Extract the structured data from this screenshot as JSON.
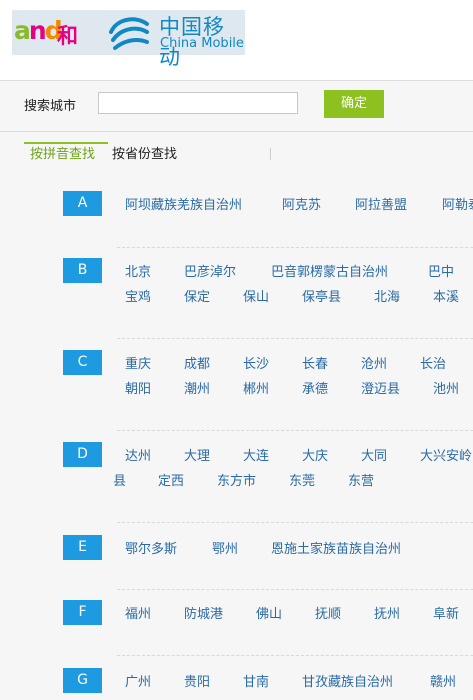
{
  "header": {
    "and_logo": {
      "a": "a",
      "n": "n",
      "d": "d"
    },
    "he_label": "和",
    "brand_cn": "中国移动",
    "brand_en": "China Mobile"
  },
  "search": {
    "label": "搜索城市",
    "input_value": "",
    "placeholder": "",
    "button_label": "确定"
  },
  "tabs": {
    "pinyin": "按拼音查找",
    "province": "按省份查找"
  },
  "colors": {
    "accent_green": "#8cc11f",
    "letter_blue": "#1d9ae0",
    "link_blue": "#2a6aa8",
    "and_green": "#8ab82f",
    "and_pink": "#e4007f",
    "and_orange": "#f08a00",
    "brand_blue": "#1088c8"
  },
  "groups": {
    "A": {
      "letter": "A",
      "cities": [
        "阿坝藏族羌族自治州",
        "阿克苏",
        "阿拉善盟",
        "阿勒泰"
      ]
    },
    "B": {
      "letter": "B",
      "cities": [
        "北京",
        "巴彦淖尔",
        "巴音郭楞蒙古自治州",
        "巴中",
        "宝鸡",
        "保定",
        "保山",
        "保亭县",
        "北海",
        "本溪"
      ]
    },
    "C": {
      "letter": "C",
      "cities": [
        "重庆",
        "成都",
        "长沙",
        "长春",
        "沧州",
        "长治",
        "朝阳",
        "潮州",
        "郴州",
        "承德",
        "澄迈县",
        "池州"
      ]
    },
    "D": {
      "letter": "D",
      "cities": [
        "达州",
        "大理",
        "大连",
        "大庆",
        "大同",
        "大兴安岭",
        "县",
        "定西",
        "东方市",
        "东莞",
        "东营"
      ]
    },
    "E": {
      "letter": "E",
      "cities": [
        "鄂尔多斯",
        "鄂州",
        "恩施土家族苗族自治州"
      ]
    },
    "F": {
      "letter": "F",
      "cities": [
        "福州",
        "防城港",
        "佛山",
        "抚顺",
        "抚州",
        "阜新"
      ]
    },
    "G": {
      "letter": "G",
      "cities": [
        "广州",
        "贵阳",
        "甘南",
        "甘孜藏族自治州",
        "赣州"
      ]
    }
  }
}
